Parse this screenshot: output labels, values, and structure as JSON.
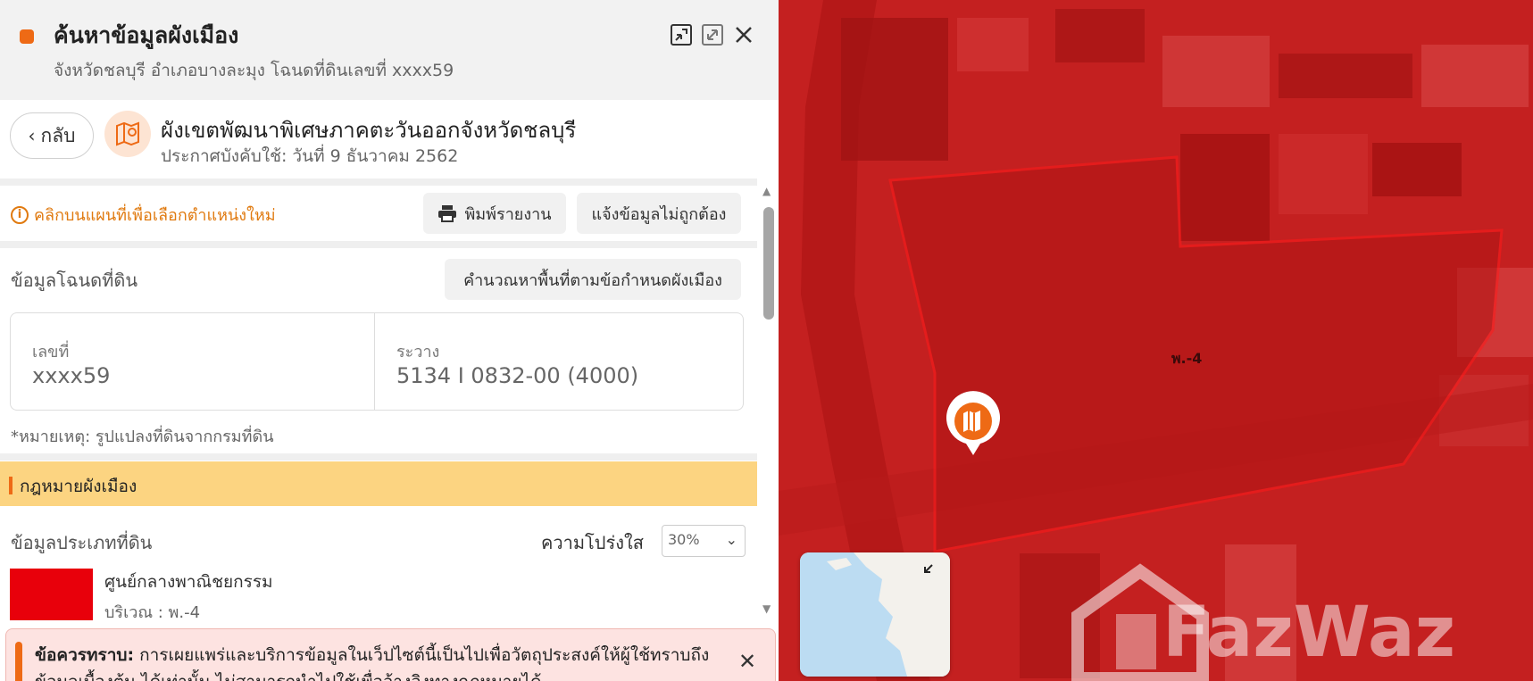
{
  "header": {
    "title": "ค้นหาข้อมูลผังเมือง",
    "subtitle": "จังหวัดชลบุรี อำเภอบางละมุง โฉนดที่ดินเลขที่ xxxx59",
    "accent_color": "#ee6a15"
  },
  "law": {
    "back_label": "กลับ",
    "title": "ผังเขตพัฒนาพิเศษภาคตะวันออกจังหวัดชลบุรี",
    "effective": "ประกาศบังคับใช้: วันที่ 9 ธันวาคม 2562"
  },
  "toolbar": {
    "hint": "คลิกบนแผนที่เพื่อเลือกตำแหน่งใหม่",
    "print_label": "พิมพ์รายงาน",
    "report_label": "แจ้งข้อมูลไม่ถูกต้อง"
  },
  "deed": {
    "section_title": "ข้อมูลโฉนดที่ดิน",
    "calc_label": "คำนวณหาพื้นที่ตามข้อกำหนดผังเมือง",
    "number_label": "เลขที่",
    "number_value": "xxxx59",
    "ravang_label": "ระวาง",
    "ravang_value": "5134 I 0832-00 (4000)",
    "note": "*หมายเหตุ: รูปแปลงที่ดินจากกรมที่ดิน"
  },
  "zoning": {
    "bar_title": "กฎหมายผังเมือง",
    "section_title": "ข้อมูลประเภทที่ดิน",
    "opacity_label": "ความโปร่งใส",
    "opacity_value": "30%",
    "zone_name": "ศูนย์กลางพาณิชยกรรม",
    "zone_area": "บริเวณ : พ.-4",
    "zone_color": "#e8000b"
  },
  "notice": {
    "bold": "ข้อควรทราบ:",
    "text": " การเผยแพร่และบริการข้อมูลในเว็ปไซต์นี้เป็นไปเพื่อวัตถุประสงค์ให้ผู้ใช้ทราบถึงข้อมูลเบื้องต้น ได้เท่านั้น ไม่สามารถนำไปใช้เพื่ออ้างอิงทางกฎหมายได้"
  },
  "map": {
    "zone_label": "พ.-4",
    "watermark": "FazWaz"
  }
}
